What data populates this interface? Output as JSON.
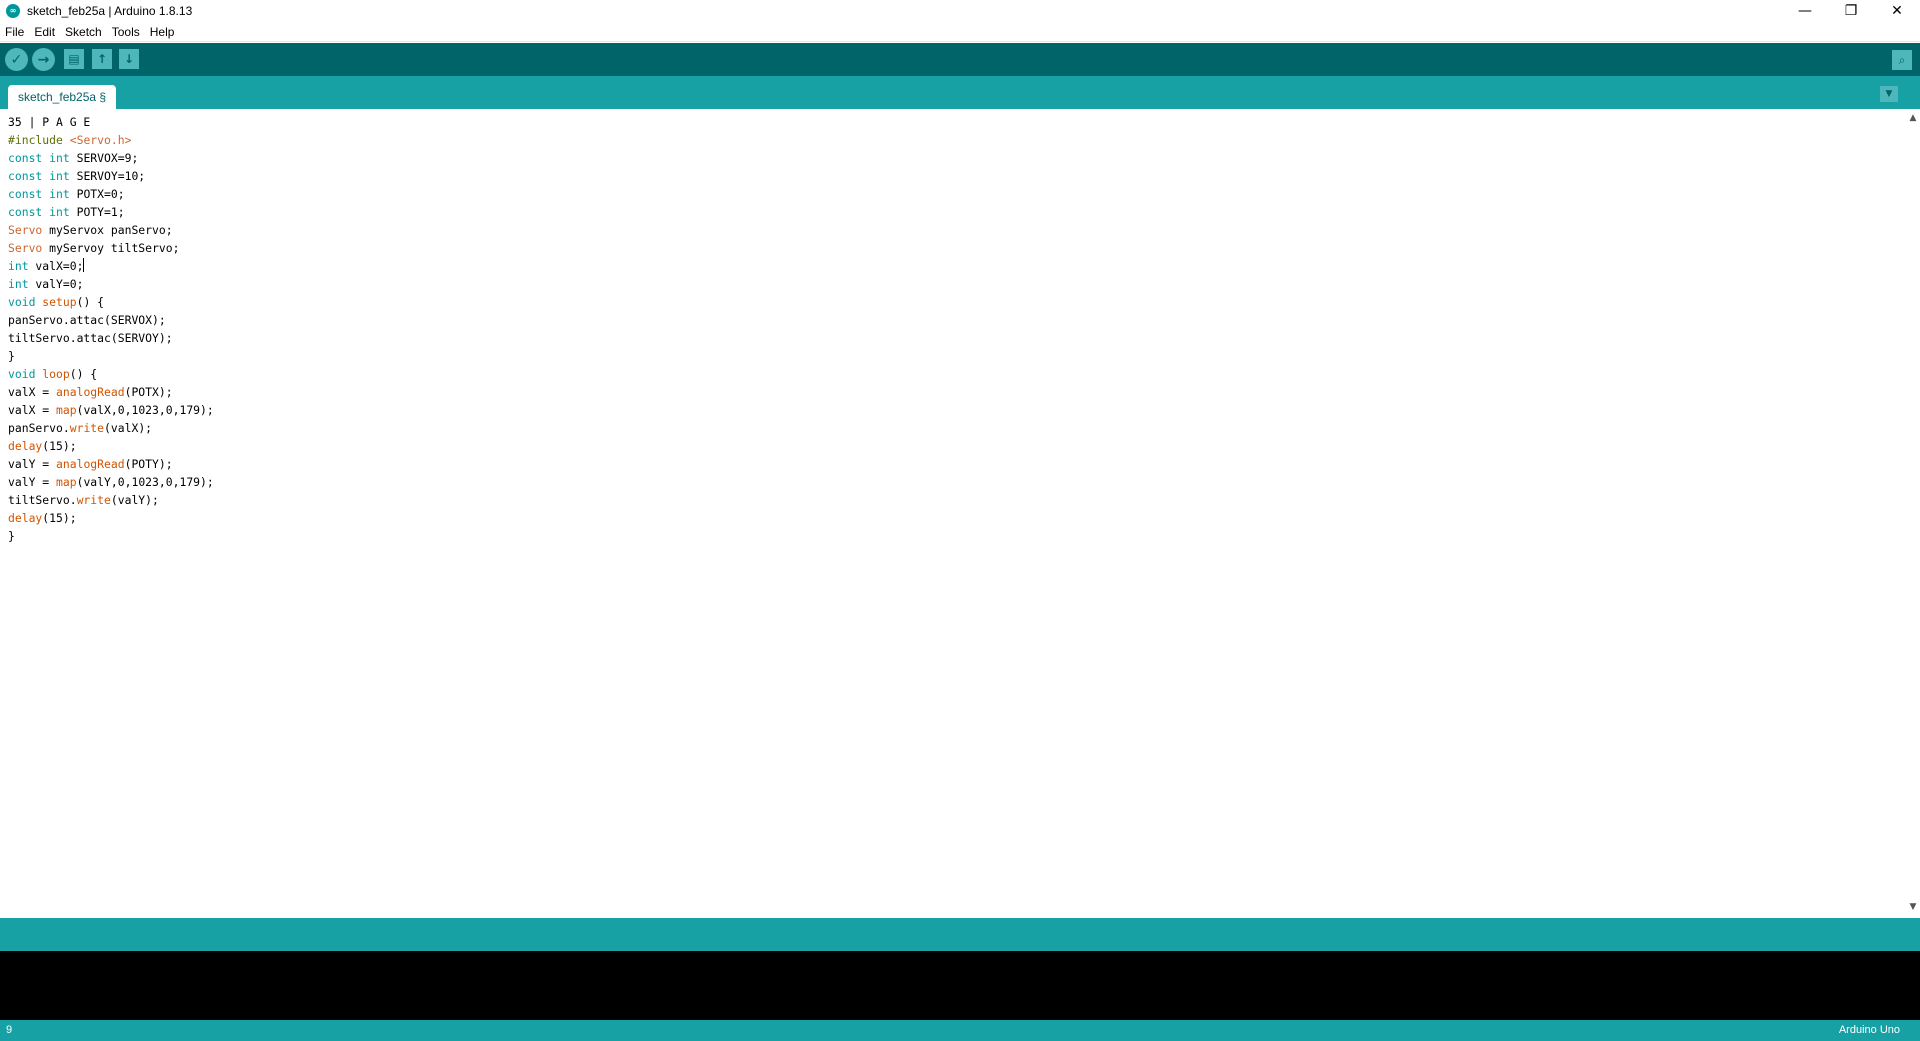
{
  "window": {
    "title": "sketch_feb25a | Arduino 1.8.13",
    "app_icon_text": "∞",
    "minimize_label": "—",
    "restore_label": "❐",
    "close_label": "✕"
  },
  "menu": [
    "File",
    "Edit",
    "Sketch",
    "Tools",
    "Help"
  ],
  "toolbar": {
    "verify_icon": "✓",
    "upload_icon": "→",
    "new_icon": "▤",
    "open_icon": "↑",
    "save_icon": "↓",
    "serial_monitor_icon": "⌕"
  },
  "tabs": [
    {
      "label": "sketch_feb25a §"
    }
  ],
  "tab_menu_icon": "▼",
  "code_lines": [
    [
      {
        "t": "35 | P A G E",
        "c": ""
      }
    ],
    [
      {
        "t": "#include ",
        "c": "pp"
      },
      {
        "t": "<Servo.h>",
        "c": "ty"
      }
    ],
    [
      {
        "t": "const",
        "c": "kw"
      },
      {
        "t": " ",
        "c": ""
      },
      {
        "t": "int",
        "c": "kw"
      },
      {
        "t": " SERVOX=9;",
        "c": ""
      }
    ],
    [
      {
        "t": "const",
        "c": "kw"
      },
      {
        "t": " ",
        "c": ""
      },
      {
        "t": "int",
        "c": "kw"
      },
      {
        "t": " SERVOY=10;",
        "c": ""
      }
    ],
    [
      {
        "t": "const",
        "c": "kw"
      },
      {
        "t": " ",
        "c": ""
      },
      {
        "t": "int",
        "c": "kw"
      },
      {
        "t": " POTX=0;",
        "c": ""
      }
    ],
    [
      {
        "t": "const",
        "c": "kw"
      },
      {
        "t": " ",
        "c": ""
      },
      {
        "t": "int",
        "c": "kw"
      },
      {
        "t": " POTY=1;",
        "c": ""
      }
    ],
    [
      {
        "t": "Servo",
        "c": "ty"
      },
      {
        "t": " myServox panServo;",
        "c": ""
      }
    ],
    [
      {
        "t": "Servo",
        "c": "ty"
      },
      {
        "t": " myServoy tiltServo;",
        "c": ""
      }
    ],
    [
      {
        "t": "int",
        "c": "kw"
      },
      {
        "t": " valX=0;",
        "c": ""
      },
      {
        "t": "",
        "c": "caret"
      }
    ],
    [
      {
        "t": "int",
        "c": "kw"
      },
      {
        "t": " valY=0;",
        "c": ""
      }
    ],
    [
      {
        "t": "void",
        "c": "kw"
      },
      {
        "t": " ",
        "c": ""
      },
      {
        "t": "setup",
        "c": "fn"
      },
      {
        "t": "() {",
        "c": ""
      }
    ],
    [
      {
        "t": "panServo.attac(SERVOX);",
        "c": ""
      }
    ],
    [
      {
        "t": "tiltServo.attac(SERVOY);",
        "c": ""
      }
    ],
    [
      {
        "t": "}",
        "c": ""
      }
    ],
    [
      {
        "t": "void",
        "c": "kw"
      },
      {
        "t": " ",
        "c": ""
      },
      {
        "t": "loop",
        "c": "fn"
      },
      {
        "t": "() {",
        "c": ""
      }
    ],
    [
      {
        "t": "valX = ",
        "c": ""
      },
      {
        "t": "analogRead",
        "c": "fn"
      },
      {
        "t": "(POTX);",
        "c": ""
      }
    ],
    [
      {
        "t": "valX = ",
        "c": ""
      },
      {
        "t": "map",
        "c": "fn"
      },
      {
        "t": "(valX,0,1023,0,179);",
        "c": ""
      }
    ],
    [
      {
        "t": "panServo.",
        "c": ""
      },
      {
        "t": "write",
        "c": "fn"
      },
      {
        "t": "(valX);",
        "c": ""
      }
    ],
    [
      {
        "t": "delay",
        "c": "fn"
      },
      {
        "t": "(15);",
        "c": ""
      }
    ],
    [
      {
        "t": "valY = ",
        "c": ""
      },
      {
        "t": "analogRead",
        "c": "fn"
      },
      {
        "t": "(POTY);",
        "c": ""
      }
    ],
    [
      {
        "t": "valY = ",
        "c": ""
      },
      {
        "t": "map",
        "c": "fn"
      },
      {
        "t": "(valY,0,1023,0,179);",
        "c": ""
      }
    ],
    [
      {
        "t": "tiltServo.",
        "c": ""
      },
      {
        "t": "write",
        "c": "fn"
      },
      {
        "t": "(valY);",
        "c": ""
      }
    ],
    [
      {
        "t": "delay",
        "c": "fn"
      },
      {
        "t": "(15);",
        "c": ""
      }
    ],
    [
      {
        "t": "}",
        "c": ""
      }
    ]
  ],
  "scrollbar": {
    "up_icon": "▲",
    "down_icon": "▼"
  },
  "status": {
    "line_number": "9",
    "board": "Arduino Uno"
  },
  "colors": {
    "toolbar_bg": "#006468",
    "tab_row_bg": "#17a1a5",
    "keyword": "#00979c",
    "function": "#d35400",
    "type": "#cc6633",
    "console_bg": "#000000"
  }
}
